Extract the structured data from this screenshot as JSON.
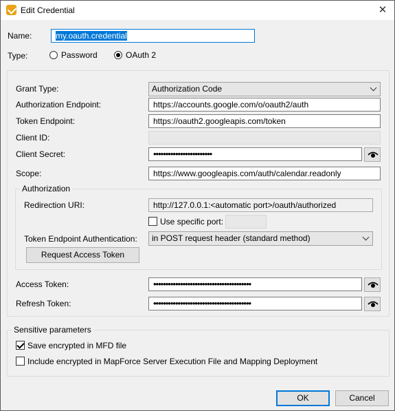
{
  "window": {
    "title": "Edit Credential"
  },
  "name": {
    "label": "Name:",
    "value": "my.oauth.credential"
  },
  "type": {
    "label": "Type:",
    "options": [
      "Password",
      "OAuth 2"
    ],
    "selected": "OAuth 2"
  },
  "oauth": {
    "grant_type": {
      "label": "Grant Type:",
      "value": "Authorization Code"
    },
    "auth_endpoint": {
      "label": "Authorization Endpoint:",
      "value": "https://accounts.google.com/o/oauth2/auth"
    },
    "token_endpoint": {
      "label": "Token Endpoint:",
      "value": "https://oauth2.googleapis.com/token"
    },
    "client_id": {
      "label": "Client ID:",
      "value": ""
    },
    "client_secret": {
      "label": "Client Secret:",
      "value": "••••••••••••••••••••••••"
    },
    "scope": {
      "label": "Scope:",
      "value": "https://www.googleapis.com/auth/calendar.readonly"
    }
  },
  "authorization": {
    "group_title": "Authorization",
    "redirection_uri": {
      "label": "Redirection URI:",
      "value": "http://127.0.0.1:<automatic port>/oauth/authorized"
    },
    "use_specific_port": {
      "label": "Use specific port:",
      "checked": false,
      "value": ""
    },
    "token_auth": {
      "label": "Token Endpoint Authentication:",
      "value": "in POST request header (standard method)"
    },
    "request_button": "Request Access Token"
  },
  "tokens": {
    "access": {
      "label": "Access Token:",
      "value": "••••••••••••••••••••••••••••••••••••••••"
    },
    "refresh": {
      "label": "Refresh Token:",
      "value": "••••••••••••••••••••••••••••••••••••••••"
    }
  },
  "sensitive": {
    "group_title": "Sensitive parameters",
    "save_mfd": {
      "label": "Save encrypted in MFD file",
      "checked": true
    },
    "include_server": {
      "label": "Include encrypted in MapForce Server Execution File and Mapping Deployment",
      "checked": false
    }
  },
  "buttons": {
    "ok": "OK",
    "cancel": "Cancel"
  },
  "colors": {
    "accent": "#0078d7",
    "app_icon": "#e8a317"
  },
  "icons": {
    "app": "mapforce-icon",
    "close": "close-icon",
    "reveal": "eye-icon"
  }
}
